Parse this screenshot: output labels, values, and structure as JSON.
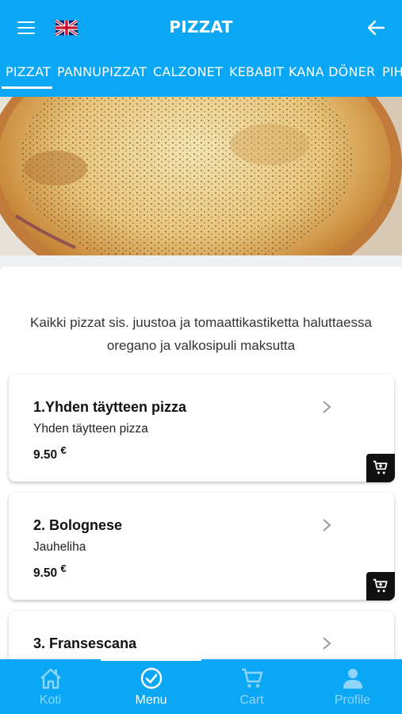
{
  "header": {
    "title": "PIZZAT",
    "menu_icon": "hamburger-icon",
    "language_icon": "uk-flag-icon",
    "back_icon": "arrow-left-icon"
  },
  "tabs": [
    {
      "label": "PIZZAT",
      "active": true
    },
    {
      "label": "PANNUPIZZAT",
      "active": false
    },
    {
      "label": "CALZONET",
      "active": false
    },
    {
      "label": "KEBABIT",
      "active": false
    },
    {
      "label": "KANA DÖNER",
      "active": false
    },
    {
      "label": "PIH",
      "active": false
    }
  ],
  "intro": {
    "line1": "Kaikki pizzat sis. juustoa ja tomaattikastiketta haluttaessa",
    "line2": "oregano ja valkosipuli maksutta"
  },
  "products": [
    {
      "name": "1.Yhden täytteen pizza",
      "description": "Yhden täytteen pizza",
      "price": "9.50",
      "currency": "€"
    },
    {
      "name": "2. Bolognese",
      "description": "Jauheliha",
      "price": "9.50",
      "currency": "€"
    },
    {
      "name": "3. Fransescana",
      "description": "",
      "price": "",
      "currency": ""
    }
  ],
  "bottom_nav": [
    {
      "label": "Koti",
      "icon": "home-icon",
      "active": false
    },
    {
      "label": "Menu",
      "icon": "check-circle-icon",
      "active": true
    },
    {
      "label": "Cart",
      "icon": "cart-icon",
      "active": false
    },
    {
      "label": "Profile",
      "icon": "person-icon",
      "active": false
    }
  ],
  "colors": {
    "primary": "#0aa7f5",
    "cart_button": "#111111",
    "inactive_nav": "#8fd5fb"
  }
}
